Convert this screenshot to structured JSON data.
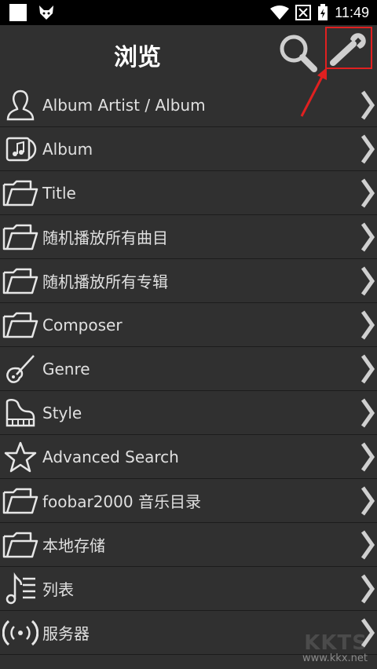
{
  "status": {
    "time": "11:49"
  },
  "header": {
    "title": "浏览"
  },
  "items": [
    {
      "label": "Album Artist / Album",
      "icon": "person-icon"
    },
    {
      "label": "Album",
      "icon": "album-icon"
    },
    {
      "label": "Title",
      "icon": "folder-icon"
    },
    {
      "label": "随机播放所有曲目",
      "icon": "folder-icon"
    },
    {
      "label": "随机播放所有专辑",
      "icon": "folder-icon"
    },
    {
      "label": "Composer",
      "icon": "folder-icon"
    },
    {
      "label": "Genre",
      "icon": "violin-icon"
    },
    {
      "label": "Style",
      "icon": "piano-icon"
    },
    {
      "label": "Advanced Search",
      "icon": "star-icon"
    },
    {
      "label": "foobar2000 音乐目录",
      "icon": "folder-icon"
    },
    {
      "label": "本地存储",
      "icon": "folder-icon"
    },
    {
      "label": "列表",
      "icon": "playlist-icon"
    },
    {
      "label": "服务器",
      "icon": "broadcast-icon"
    }
  ],
  "watermark": {
    "brand": "KKTS",
    "url": "www.kkx.net"
  },
  "colors": {
    "highlight": "#e02020",
    "background": "#303030"
  }
}
